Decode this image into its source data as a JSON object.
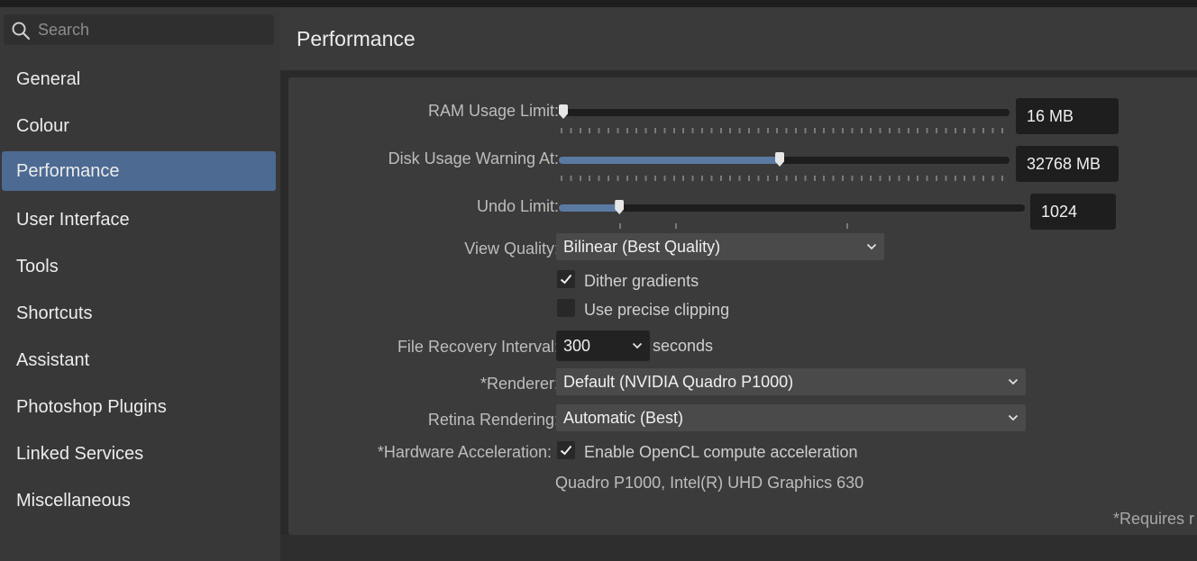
{
  "search": {
    "placeholder": "Search"
  },
  "sidebar": {
    "items": [
      {
        "label": "General"
      },
      {
        "label": "Colour"
      },
      {
        "label": "Performance"
      },
      {
        "label": "User Interface"
      },
      {
        "label": "Tools"
      },
      {
        "label": "Shortcuts"
      },
      {
        "label": "Assistant"
      },
      {
        "label": "Photoshop Plugins"
      },
      {
        "label": "Linked Services"
      },
      {
        "label": "Miscellaneous"
      }
    ],
    "active_index": 2
  },
  "header": {
    "title": "Performance"
  },
  "settings": {
    "ram": {
      "label": "RAM Usage Limit:",
      "value": "16 MB",
      "level": 0.01
    },
    "disk": {
      "label": "Disk Usage Warning At:",
      "value": "32768 MB",
      "level": 0.49
    },
    "undo": {
      "label": "Undo Limit:",
      "value": "1024",
      "level": 0.13
    },
    "view_quality": {
      "label": "View Quality:",
      "value": "Bilinear (Best Quality)"
    },
    "dither": {
      "label": "Dither gradients",
      "checked": true
    },
    "clipping": {
      "label": "Use precise clipping",
      "checked": false
    },
    "recovery": {
      "label": "File Recovery Interval:",
      "value": "300",
      "unit": "seconds"
    },
    "renderer": {
      "label": "*Renderer:",
      "value": "Default (NVIDIA Quadro P1000)"
    },
    "retina": {
      "label": "Retina Rendering:",
      "value": "Automatic (Best)"
    },
    "hw_accel": {
      "label": "*Hardware Acceleration:",
      "option": "Enable OpenCL compute acceleration",
      "checked": true,
      "devices": "Quadro P1000, Intel(R) UHD Graphics 630"
    },
    "footnote": "*Requires r"
  },
  "colors": {
    "accent": "#4c6a92",
    "slider_fill": "#5b7aa2"
  }
}
